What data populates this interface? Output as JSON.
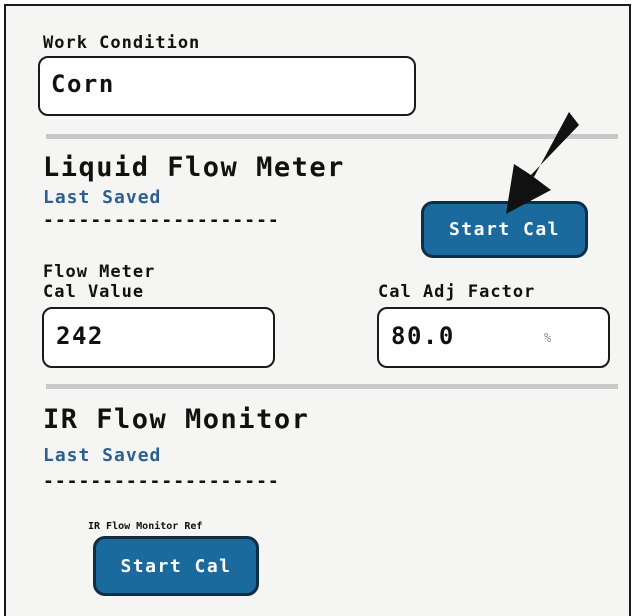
{
  "work_condition": {
    "label": "Work Condition",
    "value": "Corn"
  },
  "liquid_flow_meter": {
    "title": "Liquid Flow Meter",
    "last_saved_label": "Last Saved",
    "last_saved_value": "--------------------",
    "start_cal_label": "Start Cal",
    "cal_value_label_line1": "Flow Meter",
    "cal_value_label_line2": "Cal Value",
    "cal_value": "242",
    "adj_factor_label": "Cal Adj Factor",
    "adj_factor_value": "80.0",
    "adj_factor_unit": "%"
  },
  "ir_flow_monitor": {
    "title": "IR Flow Monitor",
    "last_saved_label": "Last Saved",
    "last_saved_value": "--------------------",
    "ref_label": "IR Flow Monitor Ref",
    "start_cal_label": "Start Cal"
  },
  "colors": {
    "button_bg": "#1a6a9e",
    "label_blue": "#2d5f93",
    "divider": "#c8c8c8"
  }
}
